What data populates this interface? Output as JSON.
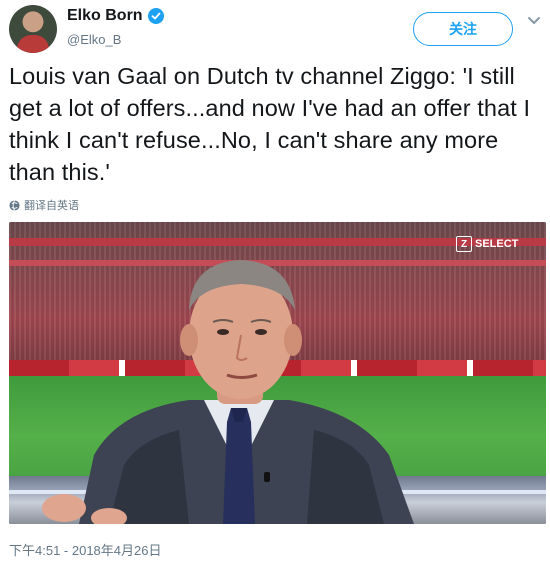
{
  "tweet": {
    "author_name": "Elko Born",
    "author_handle": "@Elko_B",
    "follow_label": "关注",
    "text": "Louis van Gaal on Dutch tv channel Ziggo: 'I still get a lot of offers...and now I've had an offer that I think I can't refuse...No, I can't share any more than this.'",
    "translate_label": "翻译自英语",
    "timestamp": "下午4:51 - 2018年4月26日"
  },
  "media": {
    "channel_logo_letter": "Z",
    "channel_logo_text": "SELECT"
  },
  "colors": {
    "accent": "#1da1f2",
    "secondary_text": "#657786",
    "primary_text": "#14171a"
  }
}
